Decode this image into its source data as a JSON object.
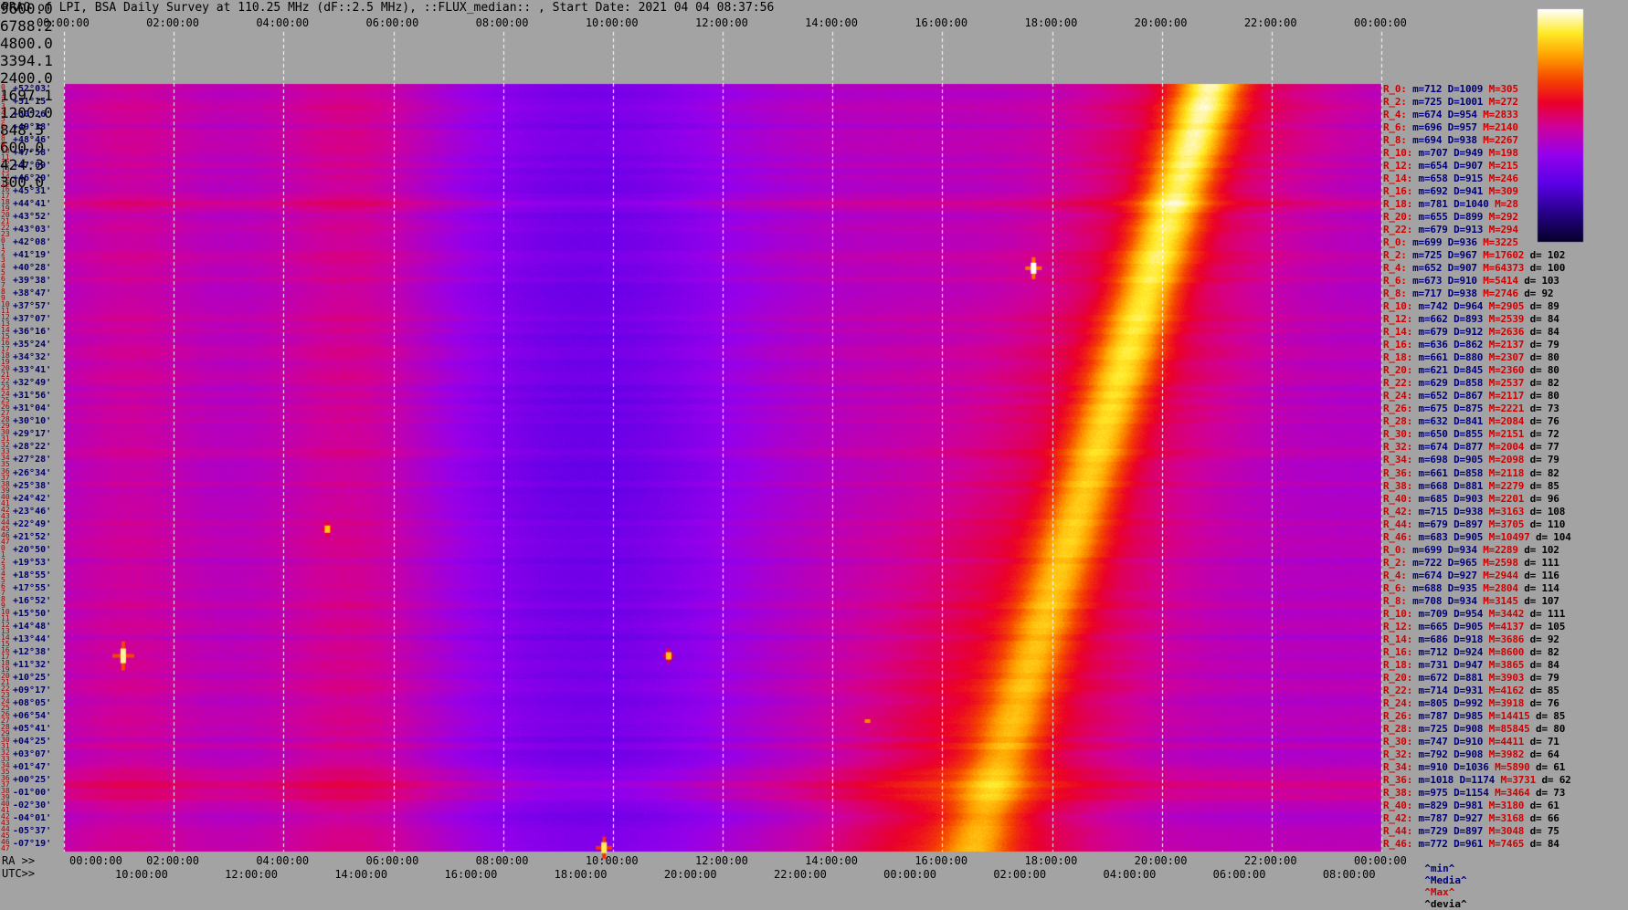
{
  "title": "PRAO of LPI, BSA Daily Survey at 110.25 MHz (dF::2.5 MHz), ::FLUX_median:: , Start Date: 2021 04 04 08:37:56",
  "top_ticks": [
    "00:00:00",
    "02:00:00",
    "04:00:00",
    "06:00:00",
    "08:00:00",
    "10:00:00",
    "12:00:00",
    "14:00:00",
    "16:00:00",
    "18:00:00",
    "20:00:00",
    "22:00:00",
    "00:00:00"
  ],
  "bottom_ra_label": "RA >>",
  "bottom_ra_ticks": [
    "00:00:00",
    "02:00:00",
    "04:00:00",
    "06:00:00",
    "08:00:00",
    "10:00:00",
    "12:00:00",
    "14:00:00",
    "16:00:00",
    "18:00:00",
    "20:00:00",
    "22:00:00",
    "00:00:00"
  ],
  "bottom_utc_label": "UTC>>",
  "bottom_utc_ticks": [
    "10:00:00",
    "12:00:00",
    "14:00:00",
    "16:00:00",
    "18:00:00",
    "20:00:00",
    "22:00:00",
    "00:00:00",
    "02:00:00",
    "04:00:00",
    "06:00:00",
    "08:00:00"
  ],
  "colorbar_ticks": [
    "9600.0",
    "6788.2",
    "4800.0",
    "3394.1",
    "2400.0",
    "1697.1",
    "1200.0",
    "848.5",
    "600.0",
    "424.3",
    "300.0"
  ],
  "declinations": [
    "+52°03'",
    "+51°15'",
    "+50°26'",
    "+49°38'",
    "+48°46'",
    "+47°58'",
    "+47°09'",
    "+46°20'",
    "+45°31'",
    "+44°41'",
    "+43°52'",
    "+43°03'",
    "+42°08'",
    "+41°19'",
    "+40°28'",
    "+39°38'",
    "+38°47'",
    "+37°57'",
    "+37°07'",
    "+36°16'",
    "+35°24'",
    "+34°32'",
    "+33°41'",
    "+32°49'",
    "+31°56'",
    "+31°04'",
    "+30°10'",
    "+29°17'",
    "+28°22'",
    "+27°28'",
    "+26°34'",
    "+25°38'",
    "+24°42'",
    "+23°46'",
    "+22°49'",
    "+21°52'",
    "+20°50'",
    "+19°53'",
    "+18°55'",
    "+17°55'",
    "+16°52'",
    "+15°50'",
    "+14°48'",
    "+13°44'",
    "+12°38'",
    "+11°32'",
    "+10°25'",
    "+09°17'",
    "+08°05'",
    "+06°54'",
    "+05°41'",
    "+04°25'",
    "+03°07'",
    "+01°47'",
    "+00°25'",
    "-01°00'",
    "-02°30'",
    "-04°01'",
    "-05°37'",
    "-07°19'"
  ],
  "row_index": [
    "0",
    "1",
    "2",
    "3",
    "4",
    "5",
    "6",
    "7",
    "8",
    "9",
    "10",
    "11",
    "12",
    "13",
    "14",
    "15",
    "16",
    "17",
    "18",
    "19",
    "20",
    "21",
    "22",
    "23",
    "0",
    "1",
    "2",
    "3",
    "4",
    "5",
    "6",
    "7",
    "8",
    "9",
    "10",
    "11",
    "12",
    "13",
    "14",
    "15",
    "16",
    "17",
    "18",
    "19",
    "20",
    "21",
    "22",
    "23",
    "24",
    "25",
    "26",
    "27",
    "28",
    "29",
    "30",
    "31",
    "32",
    "33",
    "34",
    "35",
    "36",
    "37",
    "38",
    "39",
    "40",
    "41",
    "42",
    "43",
    "44",
    "45",
    "46",
    "47",
    "0",
    "1",
    "2",
    "3",
    "4",
    "5",
    "6",
    "7",
    "8",
    "9",
    "10",
    "11",
    "12",
    "13",
    "14",
    "15",
    "16",
    "17",
    "18",
    "19",
    "20",
    "21",
    "22",
    "23",
    "24",
    "25",
    "26",
    "27",
    "28",
    "29",
    "30",
    "31",
    "32",
    "33",
    "34",
    "35",
    "36",
    "37",
    "38",
    "39",
    "40",
    "41",
    "42",
    "43",
    "44",
    "45",
    "46",
    "47"
  ],
  "stats": [
    {
      "r": "R_0:",
      "m": "m=712",
      "D": "D=1009",
      "M": "M=305",
      "d": ""
    },
    {
      "r": "R_2:",
      "m": "m=725",
      "D": "D=1001",
      "M": "M=272",
      "d": ""
    },
    {
      "r": "R_4:",
      "m": "m=674",
      "D": "D=954",
      "M": "M=2833",
      "d": ""
    },
    {
      "r": "R_6:",
      "m": "m=696",
      "D": "D=957",
      "M": "M=2140",
      "d": ""
    },
    {
      "r": "R_8:",
      "m": "m=694",
      "D": "D=938",
      "M": "M=2267",
      "d": ""
    },
    {
      "r": "R_10:",
      "m": "m=707",
      "D": "D=949",
      "M": "M=198",
      "d": ""
    },
    {
      "r": "R_12:",
      "m": "m=654",
      "D": "D=907",
      "M": "M=215",
      "d": ""
    },
    {
      "r": "R_14:",
      "m": "m=658",
      "D": "D=915",
      "M": "M=246",
      "d": ""
    },
    {
      "r": "R_16:",
      "m": "m=692",
      "D": "D=941",
      "M": "M=309",
      "d": ""
    },
    {
      "r": "R_18:",
      "m": "m=781",
      "D": "D=1040",
      "M": "M=28",
      "d": ""
    },
    {
      "r": "R_20:",
      "m": "m=655",
      "D": "D=899",
      "M": "M=292",
      "d": ""
    },
    {
      "r": "R_22:",
      "m": "m=679",
      "D": "D=913",
      "M": "M=294",
      "d": ""
    },
    {
      "r": "R_0:",
      "m": "m=699",
      "D": "D=936",
      "M": "M=3225",
      "d": ""
    },
    {
      "r": "R_2:",
      "m": "m=725",
      "D": "D=967",
      "M": "M=17602",
      "d": "d= 102"
    },
    {
      "r": "R_4:",
      "m": "m=652",
      "D": "D=907",
      "M": "M=64373",
      "d": "d= 100"
    },
    {
      "r": "R_6:",
      "m": "m=673",
      "D": "D=910",
      "M": "M=5414",
      "d": "d= 103"
    },
    {
      "r": "R_8:",
      "m": "m=717",
      "D": "D=938",
      "M": "M=2746",
      "d": "d= 92"
    },
    {
      "r": "R_10:",
      "m": "m=742",
      "D": "D=964",
      "M": "M=2905",
      "d": "d= 89"
    },
    {
      "r": "R_12:",
      "m": "m=662",
      "D": "D=893",
      "M": "M=2539",
      "d": "d= 84"
    },
    {
      "r": "R_14:",
      "m": "m=679",
      "D": "D=912",
      "M": "M=2636",
      "d": "d= 84"
    },
    {
      "r": "R_16:",
      "m": "m=636",
      "D": "D=862",
      "M": "M=2137",
      "d": "d= 79"
    },
    {
      "r": "R_18:",
      "m": "m=661",
      "D": "D=880",
      "M": "M=2307",
      "d": "d= 80"
    },
    {
      "r": "R_20:",
      "m": "m=621",
      "D": "D=845",
      "M": "M=2360",
      "d": "d= 80"
    },
    {
      "r": "R_22:",
      "m": "m=629",
      "D": "D=858",
      "M": "M=2537",
      "d": "d= 82"
    },
    {
      "r": "R_24:",
      "m": "m=652",
      "D": "D=867",
      "M": "M=2117",
      "d": "d= 80"
    },
    {
      "r": "R_26:",
      "m": "m=675",
      "D": "D=875",
      "M": "M=2221",
      "d": "d= 73"
    },
    {
      "r": "R_28:",
      "m": "m=632",
      "D": "D=841",
      "M": "M=2084",
      "d": "d= 76"
    },
    {
      "r": "R_30:",
      "m": "m=650",
      "D": "D=855",
      "M": "M=2151",
      "d": "d= 72"
    },
    {
      "r": "R_32:",
      "m": "m=674",
      "D": "D=877",
      "M": "M=2004",
      "d": "d= 77"
    },
    {
      "r": "R_34:",
      "m": "m=698",
      "D": "D=905",
      "M": "M=2098",
      "d": "d= 79"
    },
    {
      "r": "R_36:",
      "m": "m=661",
      "D": "D=858",
      "M": "M=2118",
      "d": "d= 82"
    },
    {
      "r": "R_38:",
      "m": "m=668",
      "D": "D=881",
      "M": "M=2279",
      "d": "d= 85"
    },
    {
      "r": "R_40:",
      "m": "m=685",
      "D": "D=903",
      "M": "M=2201",
      "d": "d= 96"
    },
    {
      "r": "R_42:",
      "m": "m=715",
      "D": "D=938",
      "M": "M=3163",
      "d": "d= 108"
    },
    {
      "r": "R_44:",
      "m": "m=679",
      "D": "D=897",
      "M": "M=3705",
      "d": "d= 110"
    },
    {
      "r": "R_46:",
      "m": "m=683",
      "D": "D=905",
      "M": "M=10497",
      "d": "d= 104"
    },
    {
      "r": "R_0:",
      "m": "m=699",
      "D": "D=934",
      "M": "M=2289",
      "d": "d= 102"
    },
    {
      "r": "R_2:",
      "m": "m=722",
      "D": "D=965",
      "M": "M=2598",
      "d": "d= 111"
    },
    {
      "r": "R_4:",
      "m": "m=674",
      "D": "D=927",
      "M": "M=2944",
      "d": "d= 116"
    },
    {
      "r": "R_6:",
      "m": "m=688",
      "D": "D=935",
      "M": "M=2804",
      "d": "d= 114"
    },
    {
      "r": "R_8:",
      "m": "m=708",
      "D": "D=934",
      "M": "M=3145",
      "d": "d= 107"
    },
    {
      "r": "R_10:",
      "m": "m=709",
      "D": "D=954",
      "M": "M=3442",
      "d": "d= 111"
    },
    {
      "r": "R_12:",
      "m": "m=665",
      "D": "D=905",
      "M": "M=4137",
      "d": "d= 105"
    },
    {
      "r": "R_14:",
      "m": "m=686",
      "D": "D=918",
      "M": "M=3686",
      "d": "d= 92"
    },
    {
      "r": "R_16:",
      "m": "m=712",
      "D": "D=924",
      "M": "M=8600",
      "d": "d= 82"
    },
    {
      "r": "R_18:",
      "m": "m=731",
      "D": "D=947",
      "M": "M=3865",
      "d": "d= 84"
    },
    {
      "r": "R_20:",
      "m": "m=672",
      "D": "D=881",
      "M": "M=3903",
      "d": "d= 79"
    },
    {
      "r": "R_22:",
      "m": "m=714",
      "D": "D=931",
      "M": "M=4162",
      "d": "d= 85"
    },
    {
      "r": "R_24:",
      "m": "m=805",
      "D": "D=992",
      "M": "M=3918",
      "d": "d= 76"
    },
    {
      "r": "R_26:",
      "m": "m=787",
      "D": "D=985",
      "M": "M=14415",
      "d": "d= 85"
    },
    {
      "r": "R_28:",
      "m": "m=725",
      "D": "D=908",
      "M": "M=85845",
      "d": "d= 80"
    },
    {
      "r": "R_30:",
      "m": "m=747",
      "D": "D=910",
      "M": "M=4411",
      "d": "d= 71"
    },
    {
      "r": "R_32:",
      "m": "m=792",
      "D": "D=908",
      "M": "M=3982",
      "d": "d= 64"
    },
    {
      "r": "R_34:",
      "m": "m=910",
      "D": "D=1036",
      "M": "M=5890",
      "d": "d= 61"
    },
    {
      "r": "R_36:",
      "m": "m=1018",
      "D": "D=1174",
      "M": "M=3731",
      "d": "d= 62"
    },
    {
      "r": "R_38:",
      "m": "m=975",
      "D": "D=1154",
      "M": "M=3464",
      "d": "d= 73"
    },
    {
      "r": "R_40:",
      "m": "m=829",
      "D": "D=981",
      "M": "M=3180",
      "d": "d= 61"
    },
    {
      "r": "R_42:",
      "m": "m=787",
      "D": "D=927",
      "M": "M=3168",
      "d": "d= 66"
    },
    {
      "r": "R_44:",
      "m": "m=729",
      "D": "D=897",
      "M": "M=3048",
      "d": "d= 75"
    },
    {
      "r": "R_46:",
      "m": "m=772",
      "D": "D=961",
      "M": "M=7465",
      "d": "d= 84"
    }
  ],
  "legend": {
    "min": "^min^",
    "median": "^Media^",
    "max": "^Max^",
    "devia": "^devia^"
  },
  "colors": {
    "background": "#a3a3a3",
    "gridline": "#ffffff",
    "stat_red": "#d00000",
    "stat_blue": "#00007a"
  },
  "chart_data": {
    "type": "heatmap",
    "title": "PRAO of LPI, BSA Daily Survey at 110.25 MHz (dF::2.5 MHz), ::FLUX_median:: , Start Date: 2021 04 04 08:37:56",
    "x_axis_ticks_ra": [
      "00:00:00",
      "02:00:00",
      "04:00:00",
      "06:00:00",
      "08:00:00",
      "10:00:00",
      "12:00:00",
      "14:00:00",
      "16:00:00",
      "18:00:00",
      "20:00:00",
      "22:00:00",
      "00:00:00"
    ],
    "x_axis_ticks_utc": [
      "10:00:00",
      "12:00:00",
      "14:00:00",
      "16:00:00",
      "18:00:00",
      "20:00:00",
      "22:00:00",
      "00:00:00",
      "02:00:00",
      "04:00:00",
      "06:00:00",
      "08:00:00"
    ],
    "y_axis": "declination",
    "y_range": [
      "+52°03'",
      "-07°19'"
    ],
    "color_scale": {
      "min": 300.0,
      "max": 9600.0,
      "log": true,
      "ticks": [
        9600.0,
        6788.2,
        4800.0,
        3394.1,
        2400.0,
        1697.1,
        1200.0,
        848.5,
        600.0,
        424.3,
        300.0
      ]
    },
    "grid": true
  }
}
